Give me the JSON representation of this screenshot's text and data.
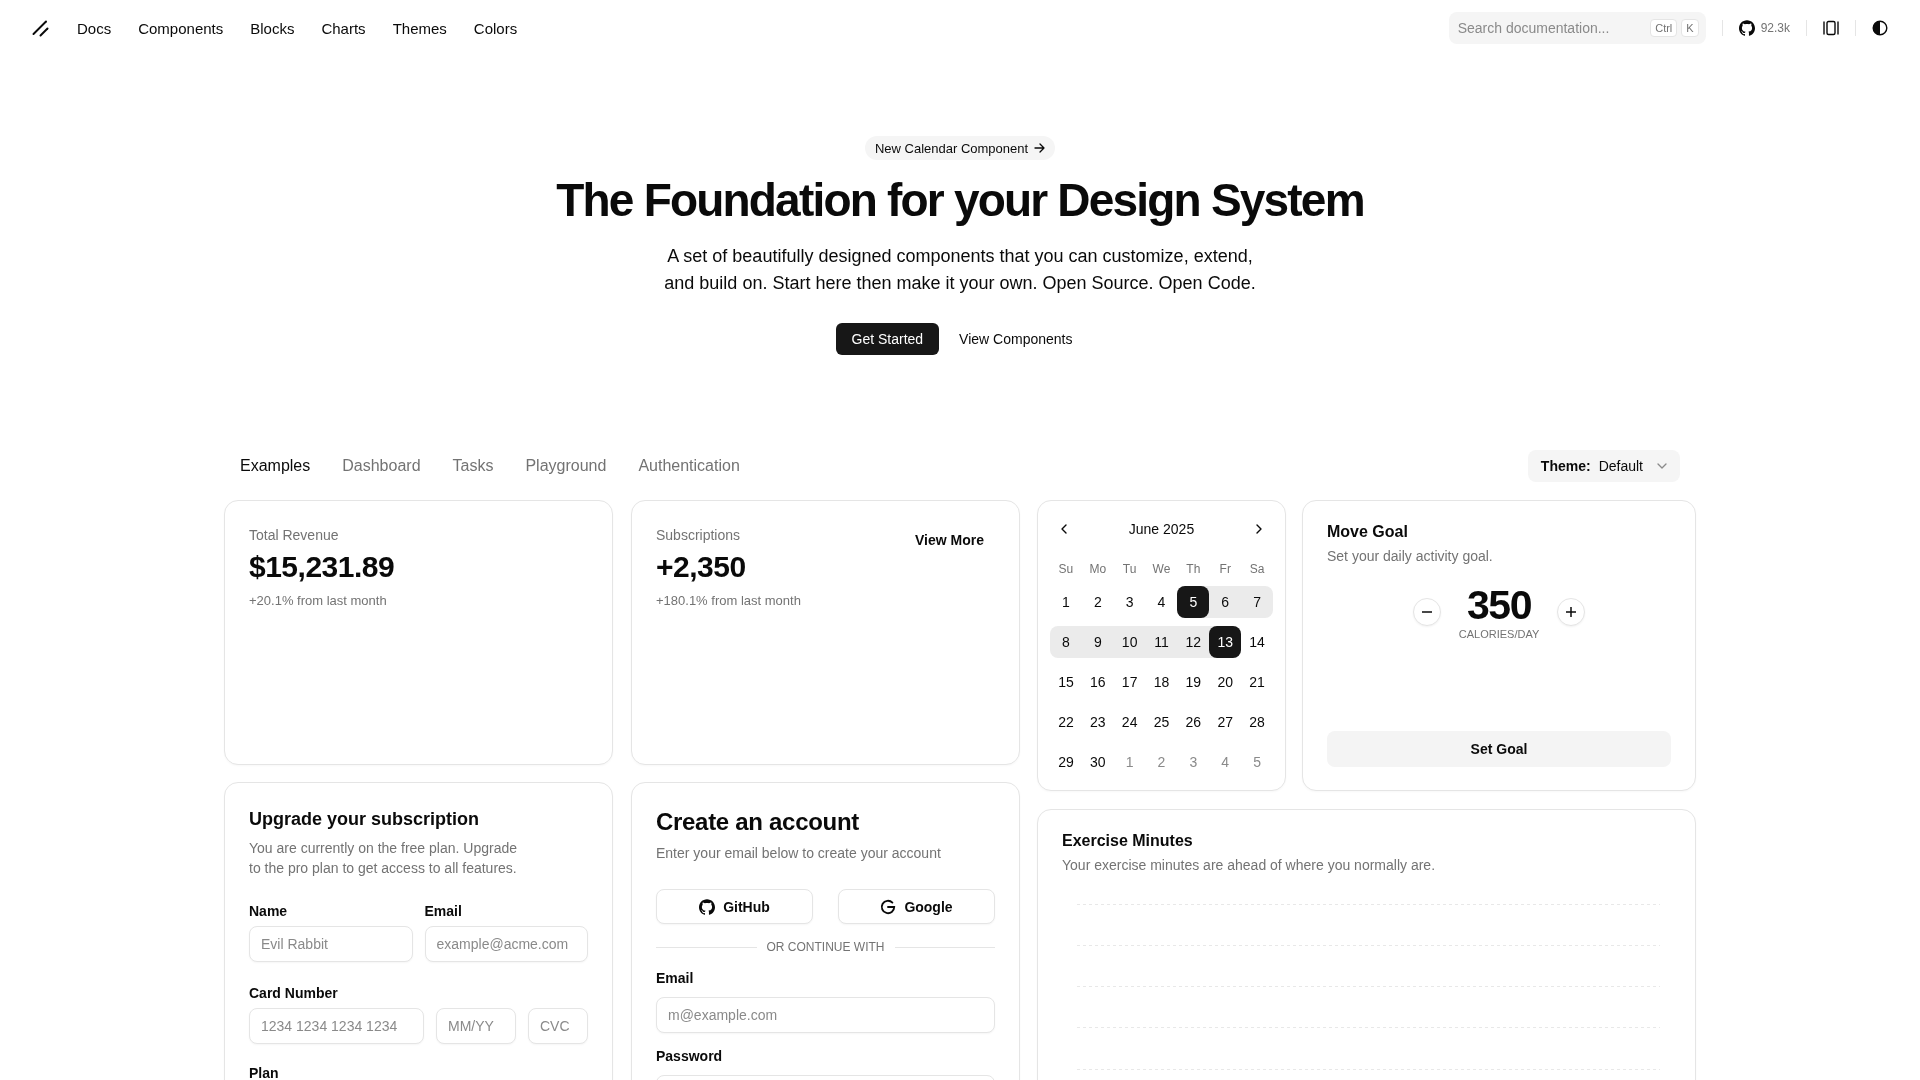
{
  "nav": {
    "links": [
      "Docs",
      "Components",
      "Blocks",
      "Charts",
      "Themes",
      "Colors"
    ],
    "search": {
      "placeholder": "Search documentation...",
      "shortcut": [
        "Ctrl",
        "K"
      ]
    },
    "github_stars": "92.3k"
  },
  "hero": {
    "announcement": "New Calendar Component",
    "title": "The Foundation for your Design System",
    "subtitle": "A set of beautifully designed components that you can customize, extend, and build on. Start here then make it your own. Open Source. Open Code.",
    "buttons": [
      {
        "label": "Get Started",
        "kind": "primary"
      },
      {
        "label": "View Components",
        "kind": "ghost"
      }
    ]
  },
  "tabs": [
    {
      "label": "Examples",
      "selected": true
    },
    {
      "label": "Dashboard",
      "selected": false
    },
    {
      "label": "Tasks",
      "selected": false
    },
    {
      "label": "Playground",
      "selected": false
    },
    {
      "label": "Authentication",
      "selected": false
    }
  ],
  "theme_select": {
    "label": "Theme:",
    "value": "Default"
  },
  "revenue_card": {
    "label": "Total Revenue",
    "value": "$15,231.89",
    "change": "+20.1% from last month"
  },
  "subscriptions_card": {
    "label": "Subscriptions",
    "value": "+2,350",
    "change": "+180.1% from last month",
    "action": "View More"
  },
  "calendar": {
    "month": "June 2025",
    "weekdays": [
      "Su",
      "Mo",
      "Tu",
      "We",
      "Th",
      "Fr",
      "Sa"
    ],
    "weeks": [
      [
        {
          "day": "1",
          "selected": false,
          "in_range": false,
          "outside": false
        },
        {
          "day": "2",
          "selected": false,
          "in_range": false,
          "outside": false
        },
        {
          "day": "3",
          "selected": false,
          "in_range": false,
          "outside": false
        },
        {
          "day": "4",
          "selected": false,
          "in_range": false,
          "outside": false
        },
        {
          "day": "5",
          "selected": true,
          "in_range": true,
          "outside": false
        },
        {
          "day": "6",
          "selected": false,
          "in_range": true,
          "outside": false
        },
        {
          "day": "7",
          "selected": false,
          "in_range": true,
          "outside": false
        }
      ],
      [
        {
          "day": "8",
          "selected": false,
          "in_range": true,
          "outside": false
        },
        {
          "day": "9",
          "selected": false,
          "in_range": true,
          "outside": false
        },
        {
          "day": "10",
          "selected": false,
          "in_range": true,
          "outside": false
        },
        {
          "day": "11",
          "selected": false,
          "in_range": true,
          "outside": false
        },
        {
          "day": "12",
          "selected": false,
          "in_range": true,
          "outside": false
        },
        {
          "day": "13",
          "selected": true,
          "in_range": true,
          "outside": false
        },
        {
          "day": "14",
          "selected": false,
          "in_range": false,
          "outside": false
        }
      ],
      [
        {
          "day": "15",
          "selected": false,
          "in_range": false,
          "outside": false
        },
        {
          "day": "16",
          "selected": false,
          "in_range": false,
          "outside": false
        },
        {
          "day": "17",
          "selected": false,
          "in_range": false,
          "outside": false
        },
        {
          "day": "18",
          "selected": false,
          "in_range": false,
          "outside": false
        },
        {
          "day": "19",
          "selected": false,
          "in_range": false,
          "outside": false
        },
        {
          "day": "20",
          "selected": false,
          "in_range": false,
          "outside": false
        },
        {
          "day": "21",
          "selected": false,
          "in_range": false,
          "outside": false
        }
      ],
      [
        {
          "day": "22",
          "selected": false,
          "in_range": false,
          "outside": false
        },
        {
          "day": "23",
          "selected": false,
          "in_range": false,
          "outside": false
        },
        {
          "day": "24",
          "selected": false,
          "in_range": false,
          "outside": false
        },
        {
          "day": "25",
          "selected": false,
          "in_range": false,
          "outside": false
        },
        {
          "day": "26",
          "selected": false,
          "in_range": false,
          "outside": false
        },
        {
          "day": "27",
          "selected": false,
          "in_range": false,
          "outside": false
        },
        {
          "day": "28",
          "selected": false,
          "in_range": false,
          "outside": false
        }
      ],
      [
        {
          "day": "29",
          "selected": false,
          "in_range": false,
          "outside": false
        },
        {
          "day": "30",
          "selected": false,
          "in_range": false,
          "outside": false
        },
        {
          "day": "1",
          "selected": false,
          "in_range": false,
          "outside": true
        },
        {
          "day": "2",
          "selected": false,
          "in_range": false,
          "outside": true
        },
        {
          "day": "3",
          "selected": false,
          "in_range": false,
          "outside": true
        },
        {
          "day": "4",
          "selected": false,
          "in_range": false,
          "outside": true
        },
        {
          "day": "5",
          "selected": false,
          "in_range": false,
          "outside": true
        }
      ]
    ]
  },
  "move_goal": {
    "title": "Move Goal",
    "description": "Set your daily activity goal.",
    "value": "350",
    "unit": "CALORIES/DAY",
    "button": "Set Goal"
  },
  "upgrade_card": {
    "title": "Upgrade your subscription",
    "description": "You are currently on the free plan. Upgrade to the pro plan to get access to all features.",
    "fields": [
      {
        "label": "Name",
        "placeholder": "Evil Rabbit"
      },
      {
        "label": "Email",
        "placeholder": "example@acme.com"
      }
    ],
    "card_number": {
      "label": "Card Number",
      "fields": [
        {
          "placeholder": "1234 1234 1234 1234"
        },
        {
          "placeholder": "MM/YY"
        },
        {
          "placeholder": "CVC"
        }
      ]
    },
    "plan_label": "Plan"
  },
  "account_card": {
    "title": "Create an account",
    "description": "Enter your email below to create your account",
    "social_buttons": [
      {
        "label": "GitHub",
        "kind": "github"
      },
      {
        "label": "Google",
        "kind": "google"
      }
    ],
    "divider": "OR CONTINUE WITH",
    "fields": [
      {
        "label": "Email",
        "placeholder": "m@example.com"
      },
      {
        "label": "Password"
      }
    ]
  },
  "exercise_card": {
    "title": "Exercise Minutes",
    "description": "Your exercise minutes are ahead of where you normally are."
  }
}
